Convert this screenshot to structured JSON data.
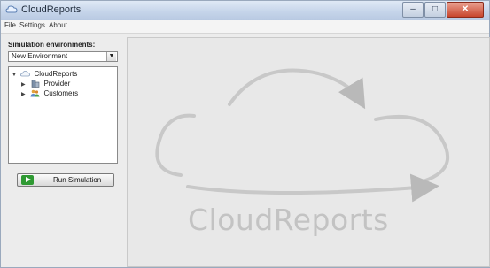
{
  "window": {
    "title": "CloudReports"
  },
  "menu": {
    "items": [
      "File",
      "Settings",
      "About"
    ]
  },
  "sidebar": {
    "heading": "Simulation environments:",
    "environment_select": {
      "value": "New Environment"
    },
    "tree": {
      "root": "CloudReports",
      "children": [
        "Provider",
        "Customers"
      ]
    },
    "run_button": "Run Simulation"
  },
  "main": {
    "logo_text": "CloudReports"
  },
  "colors": {
    "titlebar": "#c6d5ea",
    "run_icon": "#2f9a33",
    "logo_gray": "#c3c3c3"
  }
}
